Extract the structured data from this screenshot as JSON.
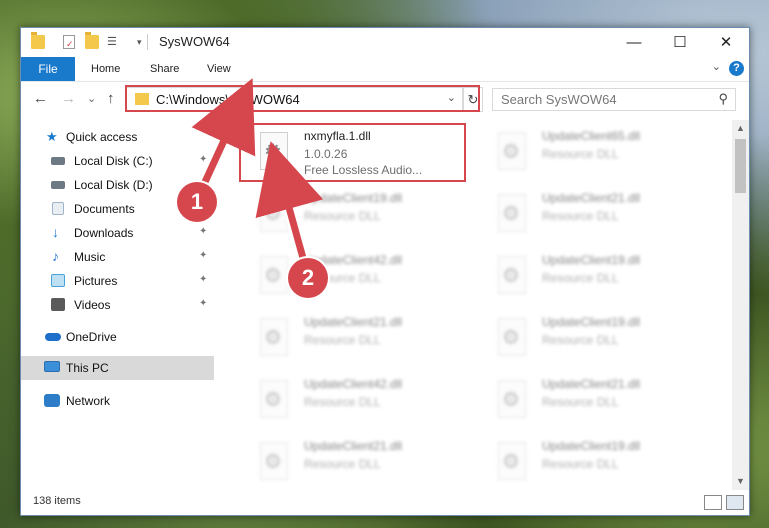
{
  "window": {
    "title": "SysWOW64",
    "minimize": "—",
    "maximize": "☐",
    "close": "✕"
  },
  "ribbon": {
    "tabs": [
      "File",
      "Home",
      "Share",
      "View"
    ],
    "help": "?",
    "expand": "⌄"
  },
  "nav": {
    "back": "←",
    "forward": "→",
    "recent": "⌄",
    "up": "↑",
    "address": "C:\\Windows\\SysWOW64",
    "address_dropdown": "⌄",
    "refresh": "↻",
    "search_placeholder": "Search SysWOW64",
    "search_icon": "⚲"
  },
  "sidebar": {
    "items": [
      {
        "label": "Quick access",
        "icon": "star-icon",
        "color": "#1979ca"
      },
      {
        "label": "Local Disk (C:)",
        "icon": "drive-icon",
        "color": "#6d7a86",
        "pinned": true
      },
      {
        "label": "Local Disk (D:)",
        "icon": "drive-icon",
        "color": "#6d7a86"
      },
      {
        "label": "Documents",
        "icon": "documents-icon",
        "color": "#9fb4c8",
        "pinned": true
      },
      {
        "label": "Downloads",
        "icon": "downloads-icon",
        "color": "#2a7bd0",
        "pinned": true
      },
      {
        "label": "Music",
        "icon": "music-icon",
        "color": "#2a7bd0",
        "pinned": true
      },
      {
        "label": "Pictures",
        "icon": "pictures-icon",
        "color": "#4aa0d8",
        "pinned": true
      },
      {
        "label": "Videos",
        "icon": "videos-icon",
        "color": "#5a5a5a",
        "pinned": true
      },
      {
        "label": "OneDrive",
        "icon": "onedrive-icon",
        "color": "#1d6fc9"
      },
      {
        "label": "This PC",
        "icon": "computer-icon",
        "color": "#3a8fd8",
        "selected": true
      },
      {
        "label": "Network",
        "icon": "network-icon",
        "color": "#2c7cc8"
      }
    ],
    "pin_glyph": "📌"
  },
  "files": [
    {
      "name": "nxmyfla.1.dll",
      "line2": "1.0.0.26",
      "line3": "Free Lossless Audio...",
      "highlighted": true
    },
    {
      "name": "UpdateClient65.dll",
      "line2": "Resource DLL"
    },
    {
      "name": "UpdateClient19.dll",
      "line2": "Resource DLL"
    },
    {
      "name": "UpdateClient21.dll",
      "line2": "Resource DLL"
    },
    {
      "name": "UpdateClient42.dll",
      "line2": "Resource DLL"
    },
    {
      "name": "UpdateClient19.dll",
      "line2": "Resource DLL"
    },
    {
      "name": "UpdateClient21.dll",
      "line2": "Resource DLL"
    },
    {
      "name": "UpdateClient19.dll",
      "line2": "Resource DLL"
    },
    {
      "name": "UpdateClient42.dll",
      "line2": "Resource DLL"
    },
    {
      "name": "UpdateClient21.dll",
      "line2": "Resource DLL"
    },
    {
      "name": "UpdateClient21.dll",
      "line2": "Resource DLL"
    },
    {
      "name": "UpdateClient19.dll",
      "line2": "Resource DLL"
    }
  ],
  "status": {
    "item_count": "138 items"
  },
  "annotations": {
    "step1": "1",
    "step2": "2",
    "color": "#d6474d"
  }
}
